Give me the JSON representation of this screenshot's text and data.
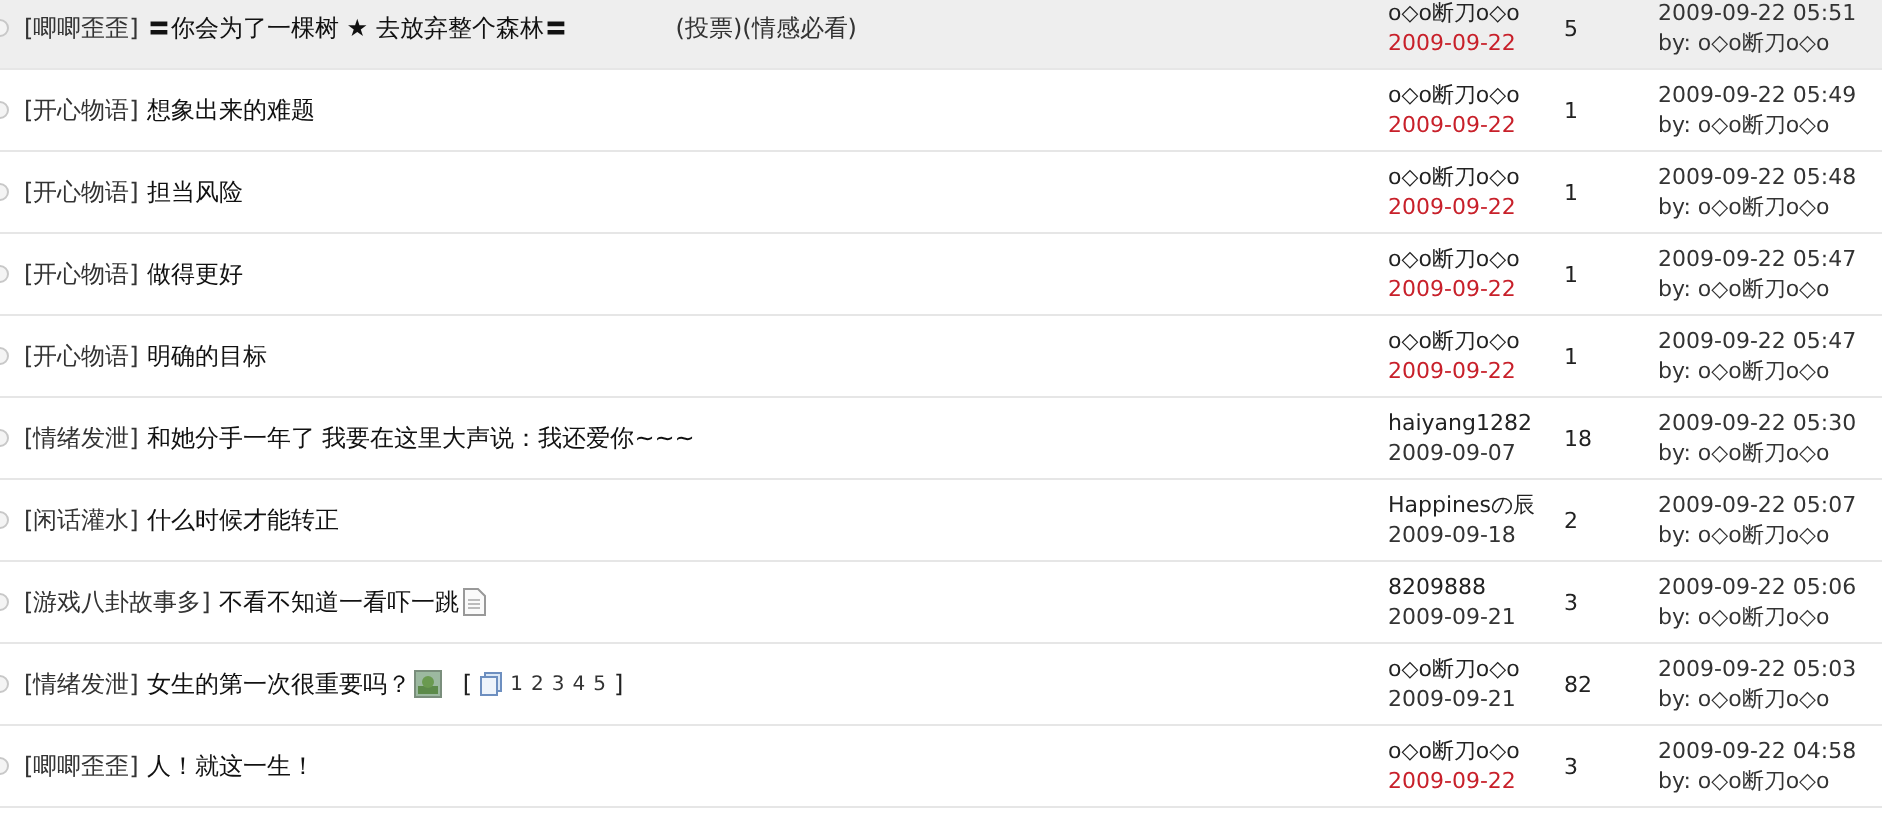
{
  "threads": [
    {
      "category": "[唧唧歪歪]",
      "title": "〓你会为了一棵树 ★ 去放弃整个森林〓",
      "tags": "(投票)(情感必看)",
      "author": "o◇o断刀o◇o",
      "date": "2009-09-22",
      "new": true,
      "replies": "5",
      "last_time": "2009-09-22 05:51",
      "last_by": "by: o◇o断刀o◇o",
      "highlighted": true
    },
    {
      "category": "[开心物语]",
      "title": "想象出来的难题",
      "author": "o◇o断刀o◇o",
      "date": "2009-09-22",
      "new": true,
      "replies": "1",
      "last_time": "2009-09-22 05:49",
      "last_by": "by: o◇o断刀o◇o",
      "highlighted": false
    },
    {
      "category": "[开心物语]",
      "title": "担当风险",
      "author": "o◇o断刀o◇o",
      "date": "2009-09-22",
      "new": true,
      "replies": "1",
      "last_time": "2009-09-22 05:48",
      "last_by": "by: o◇o断刀o◇o",
      "highlighted": false
    },
    {
      "category": "[开心物语]",
      "title": "做得更好",
      "author": "o◇o断刀o◇o",
      "date": "2009-09-22",
      "new": true,
      "replies": "1",
      "last_time": "2009-09-22 05:47",
      "last_by": "by: o◇o断刀o◇o",
      "highlighted": false
    },
    {
      "category": "[开心物语]",
      "title": "明确的目标",
      "author": "o◇o断刀o◇o",
      "date": "2009-09-22",
      "new": true,
      "replies": "1",
      "last_time": "2009-09-22 05:47",
      "last_by": "by: o◇o断刀o◇o",
      "highlighted": false
    },
    {
      "category": "[情绪发泄]",
      "title": "和她分手一年了  我要在这里大声说：我还爱你~~~",
      "author": "haiyang1282",
      "date": "2009-09-07",
      "new": false,
      "replies": "18",
      "last_time": "2009-09-22 05:30",
      "last_by": "by: o◇o断刀o◇o",
      "highlighted": false
    },
    {
      "category": "[闲话灌水]",
      "title": "什么时候才能转正",
      "author": "Happinesの辰",
      "date": "2009-09-18",
      "new": false,
      "replies": "2",
      "last_time": "2009-09-22 05:07",
      "last_by": "by: o◇o断刀o◇o",
      "highlighted": false
    },
    {
      "category": "[游戏八卦故事多]",
      "title": "不看不知道一看吓一跳",
      "kind": "document",
      "author": "8209888",
      "date": "2009-09-21",
      "new": false,
      "replies": "3",
      "last_time": "2009-09-22 05:06",
      "last_by": "by: o◇o断刀o◇o",
      "highlighted": false
    },
    {
      "category": "[情绪发泄]",
      "title": "女生的第一次很重要吗？",
      "kind": "image",
      "page_open": "[",
      "pages": [
        "1",
        "2",
        "3",
        "4",
        "5"
      ],
      "page_close": "]",
      "author": "o◇o断刀o◇o",
      "date": "2009-09-21",
      "new": false,
      "replies": "82",
      "last_time": "2009-09-22 05:03",
      "last_by": "by: o◇o断刀o◇o",
      "highlighted": false
    },
    {
      "category": "[唧唧歪歪]",
      "title": "人！就这一生！",
      "author": "o◇o断刀o◇o",
      "date": "2009-09-22",
      "new": true,
      "replies": "3",
      "last_time": "2009-09-22 04:58",
      "last_by": "by: o◇o断刀o◇o",
      "highlighted": false
    }
  ]
}
